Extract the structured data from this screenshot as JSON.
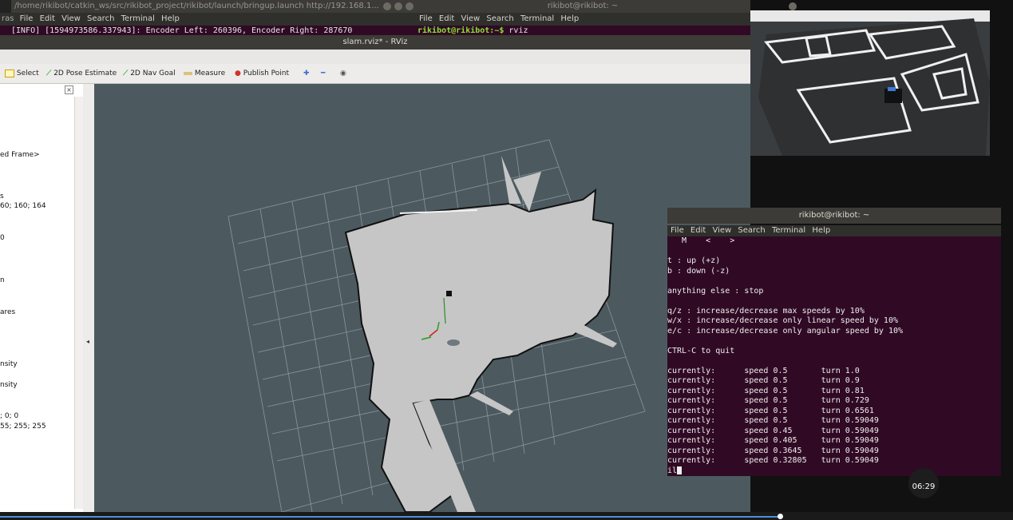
{
  "terminal1": {
    "title": "/home/rikibot/catkin_ws/src/rikibot_project/rikibot/launch/bringup.launch http://192.168.1...",
    "menu": [
      "File",
      "Edit",
      "View",
      "Search",
      "Terminal",
      "Help"
    ],
    "side_text": "ras",
    "output": "[INFO] [1594973586.337943]: Encoder Left: 260396, Encoder Right: 287670"
  },
  "terminal2": {
    "title": "rikibot@rikibot: ~",
    "menu": [
      "File",
      "Edit",
      "View",
      "Search",
      "Terminal",
      "Help"
    ],
    "prompt": "rikibot@rikibot:~$",
    "command": "rviz"
  },
  "rviz": {
    "title": "slam.rviz* - RViz",
    "tools": {
      "select": "Select",
      "pose": "2D Pose Estimate",
      "navgoal": "2D Nav Goal",
      "measure": "Measure",
      "publish": "Publish Point"
    },
    "side_props": [
      "ed Frame>",
      "s",
      "60; 160; 164",
      "0",
      "n",
      "ares",
      "nsity",
      "nsity",
      "; 0; 0",
      "55; 255; 255"
    ]
  },
  "teleop": {
    "title": "rikibot@rikibot: ~",
    "menu": [
      "File",
      "Edit",
      "View",
      "Search",
      "Terminal",
      "Help"
    ],
    "lines": [
      "   M    <    >",
      "",
      "t : up (+z)",
      "b : down (-z)",
      "",
      "anything else : stop",
      "",
      "q/z : increase/decrease max speeds by 10%",
      "w/x : increase/decrease only linear speed by 10%",
      "e/c : increase/decrease only angular speed by 10%",
      "",
      "CTRL-C to quit",
      "",
      "currently:      speed 0.5       turn 1.0",
      "currently:      speed 0.5       turn 0.9",
      "currently:      speed 0.5       turn 0.81",
      "currently:      speed 0.5       turn 0.729",
      "currently:      speed 0.5       turn 0.6561",
      "currently:      speed 0.5       turn 0.59049",
      "currently:      speed 0.45      turn 0.59049",
      "currently:      speed 0.405     turn 0.59049",
      "currently:      speed 0.3645    turn 0.59049",
      "currently:      speed 0.32805   turn 0.59049",
      "il"
    ]
  },
  "video": {
    "time": "06:29",
    "progress": 0.77
  },
  "colors": {
    "terminal_bg": "#300a24",
    "viewport_bg": "#4c5a60",
    "map_free": "#c8c8c8"
  }
}
